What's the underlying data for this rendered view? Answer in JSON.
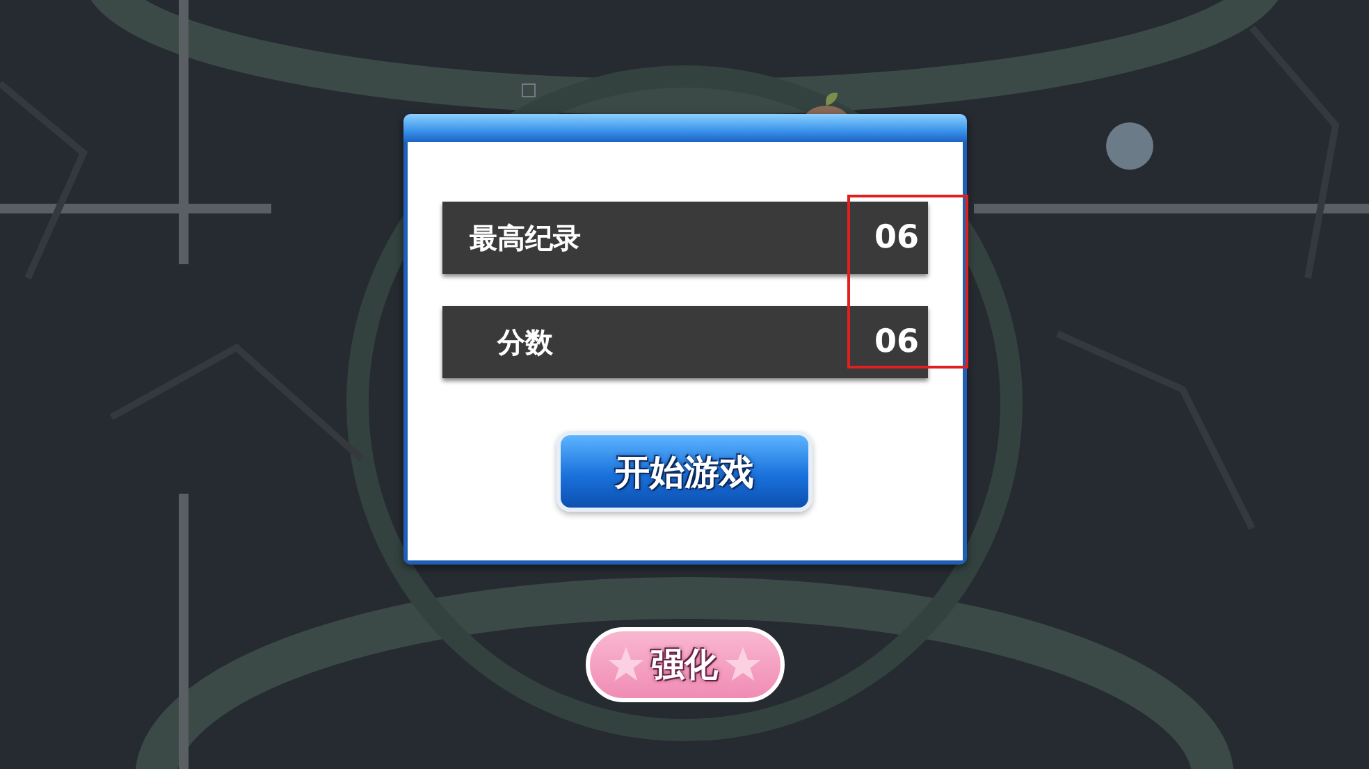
{
  "score_panel": {
    "rows": [
      {
        "label": "最高纪录",
        "value": "06"
      },
      {
        "label": "分数",
        "value": "06"
      }
    ],
    "start_button": "开始游戏"
  },
  "upgrade_button": "强化"
}
